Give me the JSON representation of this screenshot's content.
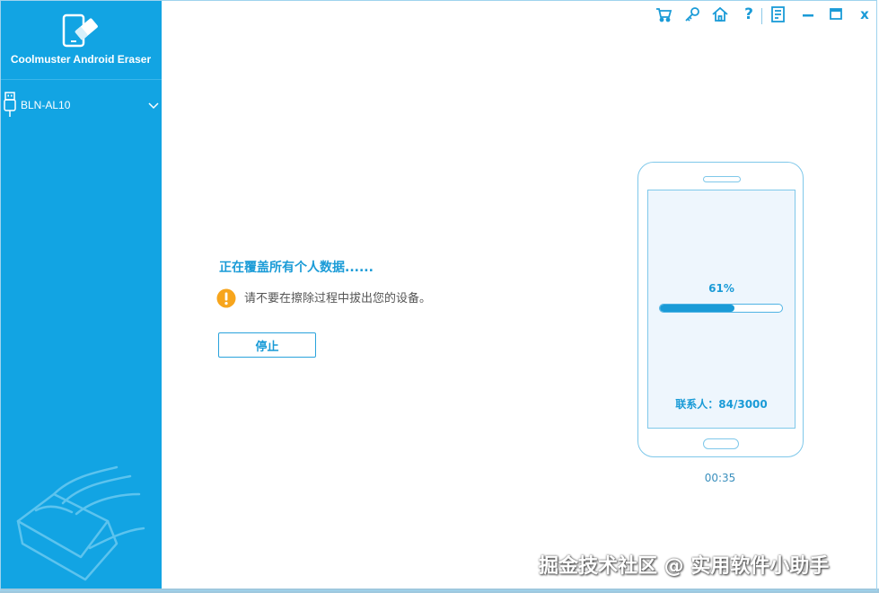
{
  "app": {
    "title": "Coolmuster Android Eraser",
    "accent_color": "#12a4e3"
  },
  "sidebar": {
    "device": {
      "name": "BLN-AL10",
      "icon": "usb-icon"
    }
  },
  "toolbar": {
    "icons": [
      "cart-icon",
      "key-icon",
      "home-icon",
      "help-icon",
      "feedback-icon",
      "minimize-icon",
      "maximize-icon",
      "close-icon"
    ],
    "help_label": "?",
    "close_label": "x"
  },
  "main": {
    "status_title": "正在覆盖所有个人数据......",
    "warning_text": "请不要在擦除过程中拔出您的设备。",
    "stop_button_label": "停止"
  },
  "phone": {
    "percent_label": "61%",
    "progress": 0.61,
    "count_label": "联系人：",
    "count_value": "84/3000"
  },
  "timer": "00:35",
  "watermark": "掘金技术社区 @ 实用软件小助手"
}
